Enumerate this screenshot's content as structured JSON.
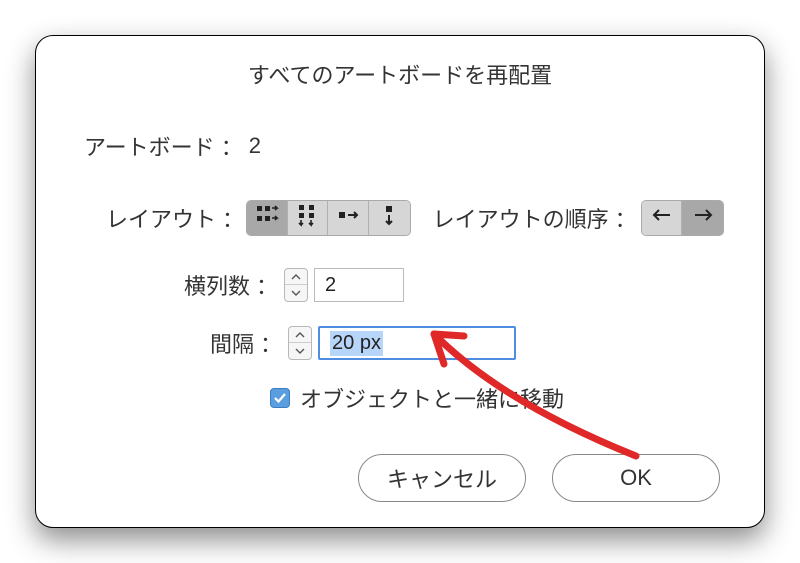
{
  "dialog": {
    "title": "すべてのアートボードを再配置"
  },
  "artboard": {
    "label": "アートボード",
    "count": "2"
  },
  "layout": {
    "label": "レイアウト",
    "icons": [
      "grid-row-icon",
      "grid-col-icon",
      "row-icon",
      "col-icon"
    ],
    "selected": 0
  },
  "order": {
    "label": "レイアウトの順序",
    "icons": [
      "left-arrow-icon",
      "right-arrow-icon"
    ],
    "selected": 1
  },
  "columns": {
    "label": "横列数",
    "value": "2"
  },
  "spacing": {
    "label": "間隔",
    "value": "20 px"
  },
  "move_with": {
    "label": "オブジェクトと一緒に移動",
    "checked": true
  },
  "buttons": {
    "cancel": "キャンセル",
    "ok": "OK"
  }
}
